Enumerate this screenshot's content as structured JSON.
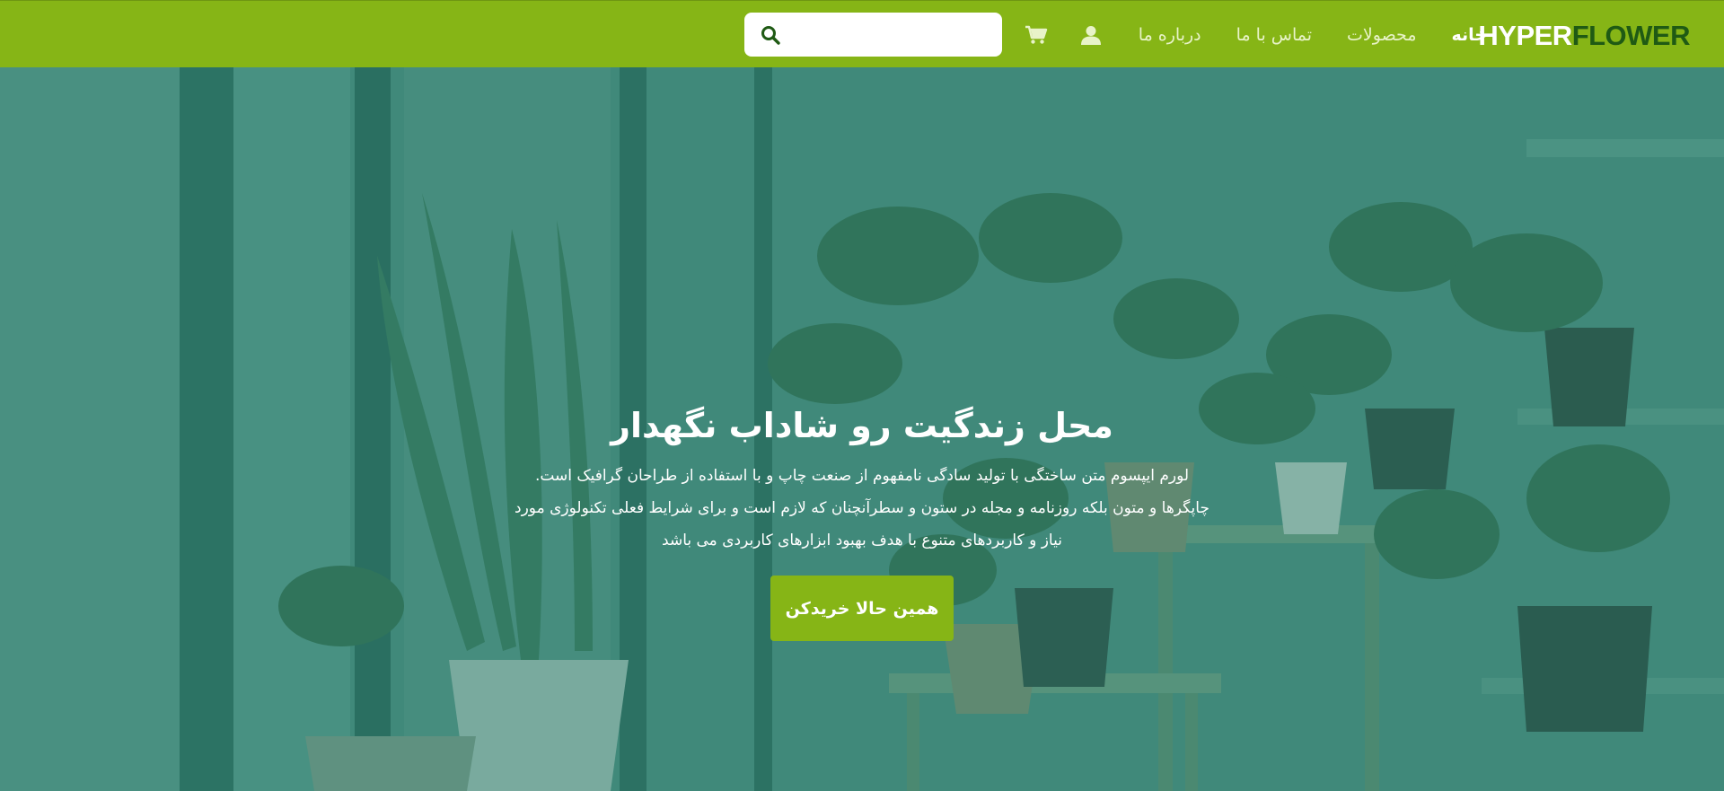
{
  "brand": {
    "logo_part1": "HYPER",
    "logo_part2": "FLOWER",
    "logo_color_white": "#ffffff",
    "logo_color_green": "#1f5a14"
  },
  "nav": {
    "items": [
      {
        "label": "خانه",
        "active": true
      },
      {
        "label": "محصولات",
        "active": false
      },
      {
        "label": "تماس با ما",
        "active": false
      },
      {
        "label": "درباره ما",
        "active": false
      }
    ],
    "user_icon": "user-icon",
    "cart_icon": "cart-icon",
    "search_icon": "search-icon",
    "search_placeholder": "",
    "bar_color": "#86b516"
  },
  "hero": {
    "title": "محل زندگیت رو شاداب نگهدار",
    "paragraph": "لورم ایپسوم متن ساختگی با تولید سادگی نامفهوم از صنعت چاپ و با استفاده از طراحان گرافیک است. چاپگرها و متون بلکه روزنامه و مجله در ستون و سطرآنچنان که لازم است و برای شرایط فعلی تکنولوژی مورد نیاز و کاربردهای متنوع با هدف بهبود ابزارهای کاربردی می باشد",
    "cta_label": "همین حالا خریدکن",
    "overlay_color": "#287d6c",
    "cta_color": "#86b516"
  }
}
